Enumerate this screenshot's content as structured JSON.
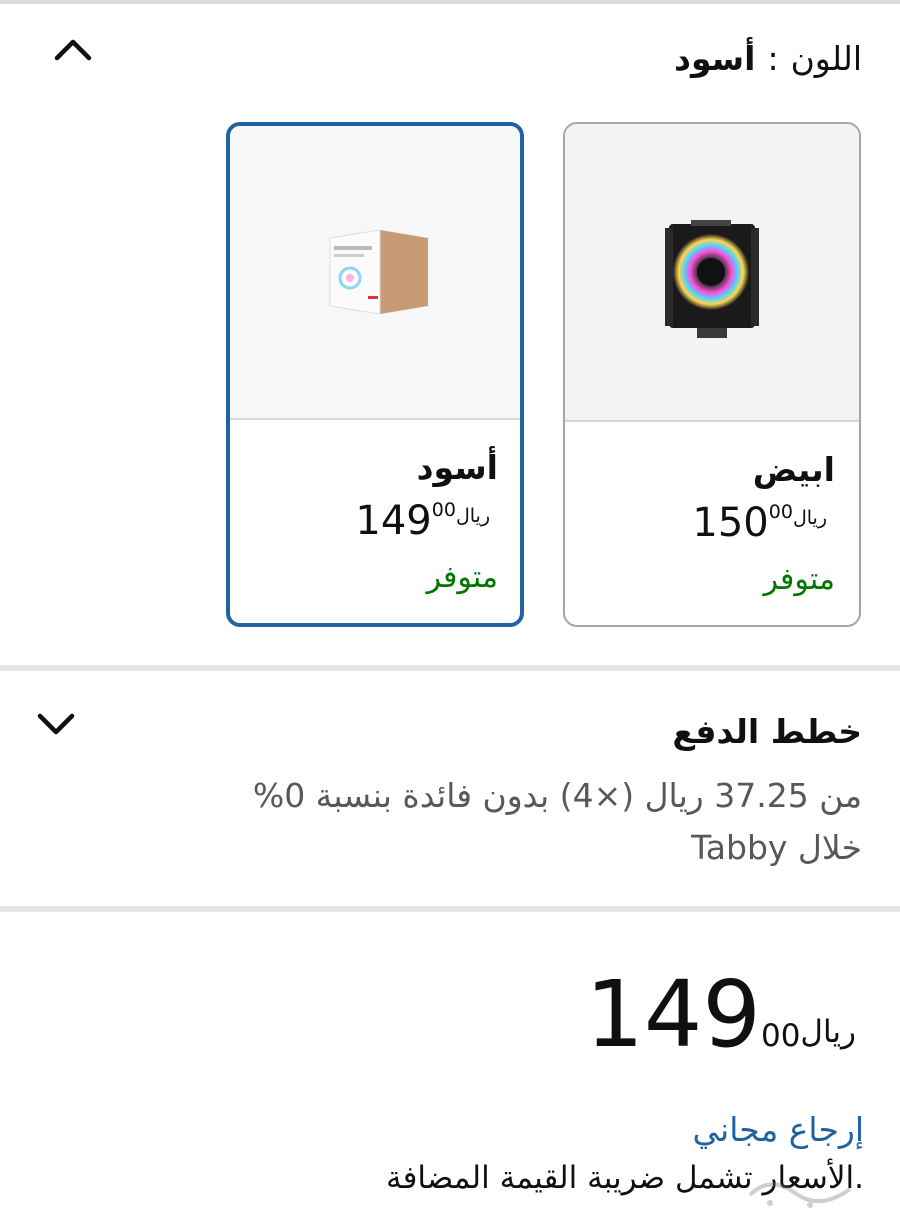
{
  "color_selector": {
    "label": "اللون",
    "separator": ":",
    "selected_value": "أسود",
    "collapse_icon": "chevron-up-icon",
    "options": [
      {
        "name": "ابيض",
        "price_int": "150",
        "price_dec": "00",
        "currency": "ريال",
        "stock": "متوفر",
        "image": "cpu-cooler-rgb-fan-product",
        "selected": false
      },
      {
        "name": "أسود",
        "price_int": "149",
        "price_dec": "00",
        "currency": "ريال",
        "stock": "متوفر",
        "image": "boxed-cooler-packaging-product",
        "selected": true
      }
    ]
  },
  "payment_plans": {
    "title": "خطط الدفع",
    "description": "من 37.25 ريال (×4) بدون فائدة بنسبة 0% خلال Tabby",
    "expand_icon": "chevron-down-icon"
  },
  "price": {
    "integer": "149",
    "decimal": "00",
    "currency": "ريال"
  },
  "free_return": "إرجاع مجاني",
  "vat_note": ".الأسعار تشمل ضريبة القيمة المضافة",
  "colors": {
    "selected_border": "#2162a1",
    "in_stock": "#007600",
    "link": "#2162a1",
    "card_border": "#a2a6ac"
  }
}
